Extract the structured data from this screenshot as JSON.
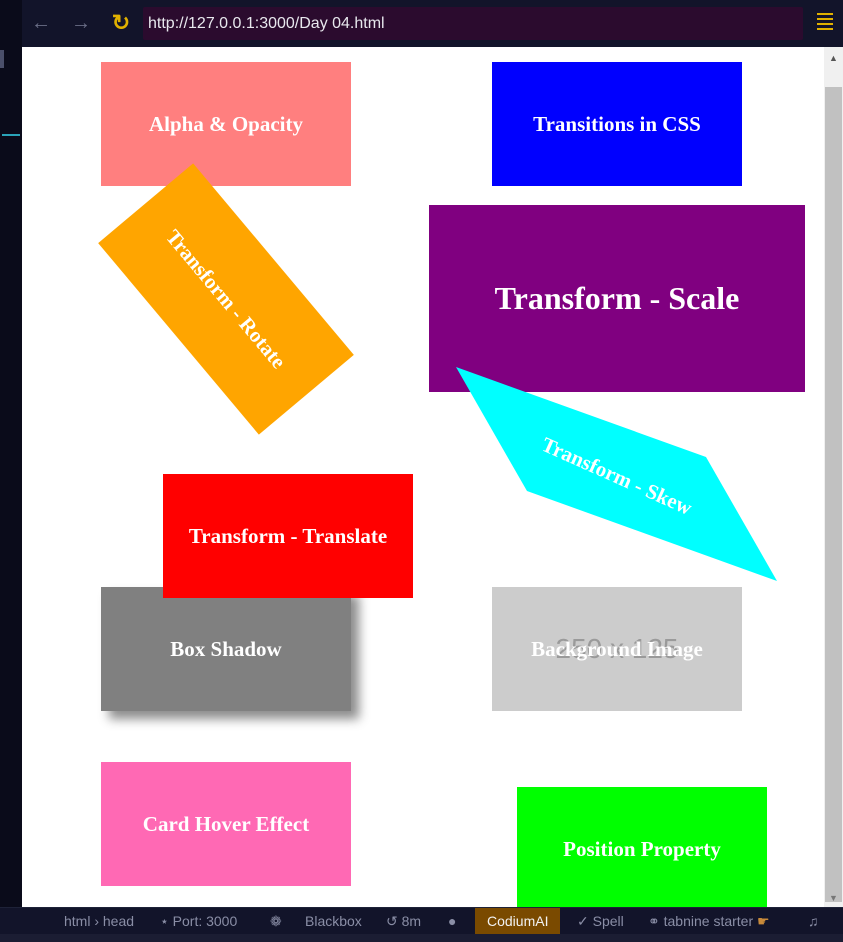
{
  "browser": {
    "url": "http://127.0.0.1:3000/Day 04.html"
  },
  "cards": {
    "alpha": {
      "label": "Alpha & Opacity",
      "color": "#ff7f7f"
    },
    "transitions": {
      "label": "Transitions in CSS",
      "color": "#0000ff"
    },
    "rotate": {
      "label": "Transform - Rotate",
      "color": "#ffa500"
    },
    "scale": {
      "label": "Transform - Scale",
      "color": "#800080"
    },
    "skew": {
      "label": "Transform - Skew",
      "color": "#00ffff"
    },
    "translate": {
      "label": "Transform - Translate",
      "color": "#ff0000"
    },
    "shadow": {
      "label": "Box Shadow",
      "color": "#808080"
    },
    "background": {
      "label": "Background Image",
      "placeholder_text": "250 x 125",
      "color": "#cccccc"
    },
    "hover": {
      "label": "Card Hover Effect",
      "color": "#ff69b4"
    },
    "position": {
      "label": "Position Property",
      "color": "#00ff00"
    }
  },
  "statusbar": {
    "breadcrumb": "html › head",
    "port": "Port: 3000",
    "blackbox": "Blackbox",
    "time": "8m",
    "codium": "CodiumAI",
    "spell": "Spell",
    "tabnine": "tabnine starter"
  }
}
